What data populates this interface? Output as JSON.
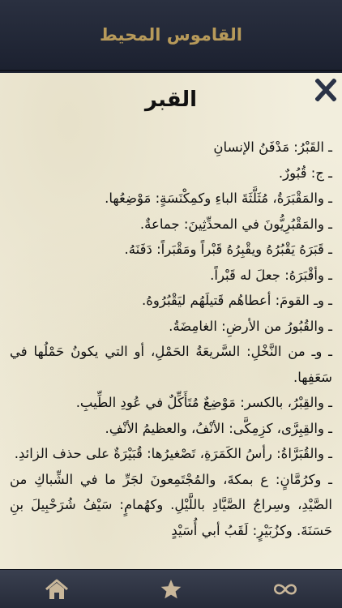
{
  "header": {
    "title": "القاموس المحيط"
  },
  "entry": {
    "word": "القبر",
    "lines": [
      "ـ القَبْرُ: مَدْفَنُ الإنسانِ",
      "ـ ج: قُبُورٌ.",
      "ـ والمَقْبَرَةُ، مُثَلَّثَةَ الباءِ وكمِكْنَسَةٍ: مَوْضِعُها.",
      "ـ والمَقْبُرِيُّونَ في المحدِّثِينَ: جماعةٌ.",
      "ـ قَبَرَهُ يَقْبُرُهُ ويقْبِرُهُ قَبْراً ومَقْبَراً: دَفَنَهُ.",
      "ـ وأقْبَرَهُ: جعلَ له قَبْراً.",
      "ـ وـ القومَ: أعطاهُم قَتيلَهُم ليَقْبُرُوهُ.",
      "ـ والقُبُورُ من الأرضِ: الغامِضَةُ.",
      "ـ وـ من النَّخْلِ: السَّريعَةُ الحَمْلِ، أو التي يكونُ حَمْلُها في سَعَفِها.",
      "ـ والقِبْرُ، بالكسر: مَوْضِعٌ مُتَأَكِّلٌ في عُودِ الطِّيبِ.",
      "ـ والقِبِرَّى، كزِمِكَّى: الأنْفُ، والعظيمُ الأنْفِ.",
      "ـ والقُبَرَّاةُ: رأسُ الكَمَرَةِ، تَصْغيرُها: قُبَيْرَةٌ على حذف الزائدِ.",
      "ـ وكرُمَّانٍ: ع بمكةَ، والمُجْتَمِعونَ لجَرِّ ما في الشِّباكِ من الصَّيْدِ، وسِراجُ الصَّيَّادِ باللَّيْلِ. وكهُمامٍ: سَيْفُ شُرَحْبِيلَ بنِ حَسَنَةَ. وكزُبَيْرٍ: لَقَبُ أبي أُسَيْدٍ"
    ]
  },
  "tabs": {
    "home": "home-icon",
    "favorites": "star-icon",
    "more": "infinity-icon"
  },
  "colors": {
    "header_bg": "#222736",
    "header_text": "#b79a5a",
    "paper_bg": "#f2eedd",
    "close_icon": "#2b3347",
    "tab_icon": "#c9b79a"
  }
}
